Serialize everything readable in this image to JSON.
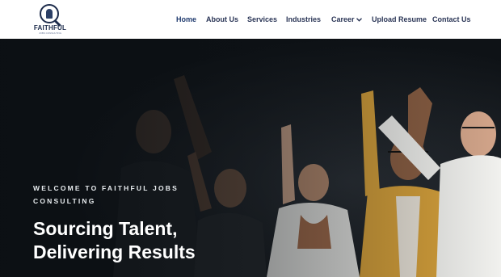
{
  "logo": {
    "name": "FAITHFUL",
    "tagline": "JOBS CONSULTING"
  },
  "nav": {
    "items": [
      {
        "label": "Home",
        "active": true
      },
      {
        "label": "About Us"
      },
      {
        "label": "Services"
      },
      {
        "label": "Industries"
      },
      {
        "label": "Career",
        "has_dropdown": true
      },
      {
        "label": "Upload Resume"
      },
      {
        "label": "Contact Us"
      }
    ]
  },
  "hero": {
    "eyebrow": "Welcome to Faithful Jobs Consulting",
    "headline": "Sourcing Talent, Delivering Results"
  },
  "colors": {
    "brand": "#1b2a4a",
    "nav_text": "#2a3556",
    "hero_bg": "#0e1216"
  }
}
